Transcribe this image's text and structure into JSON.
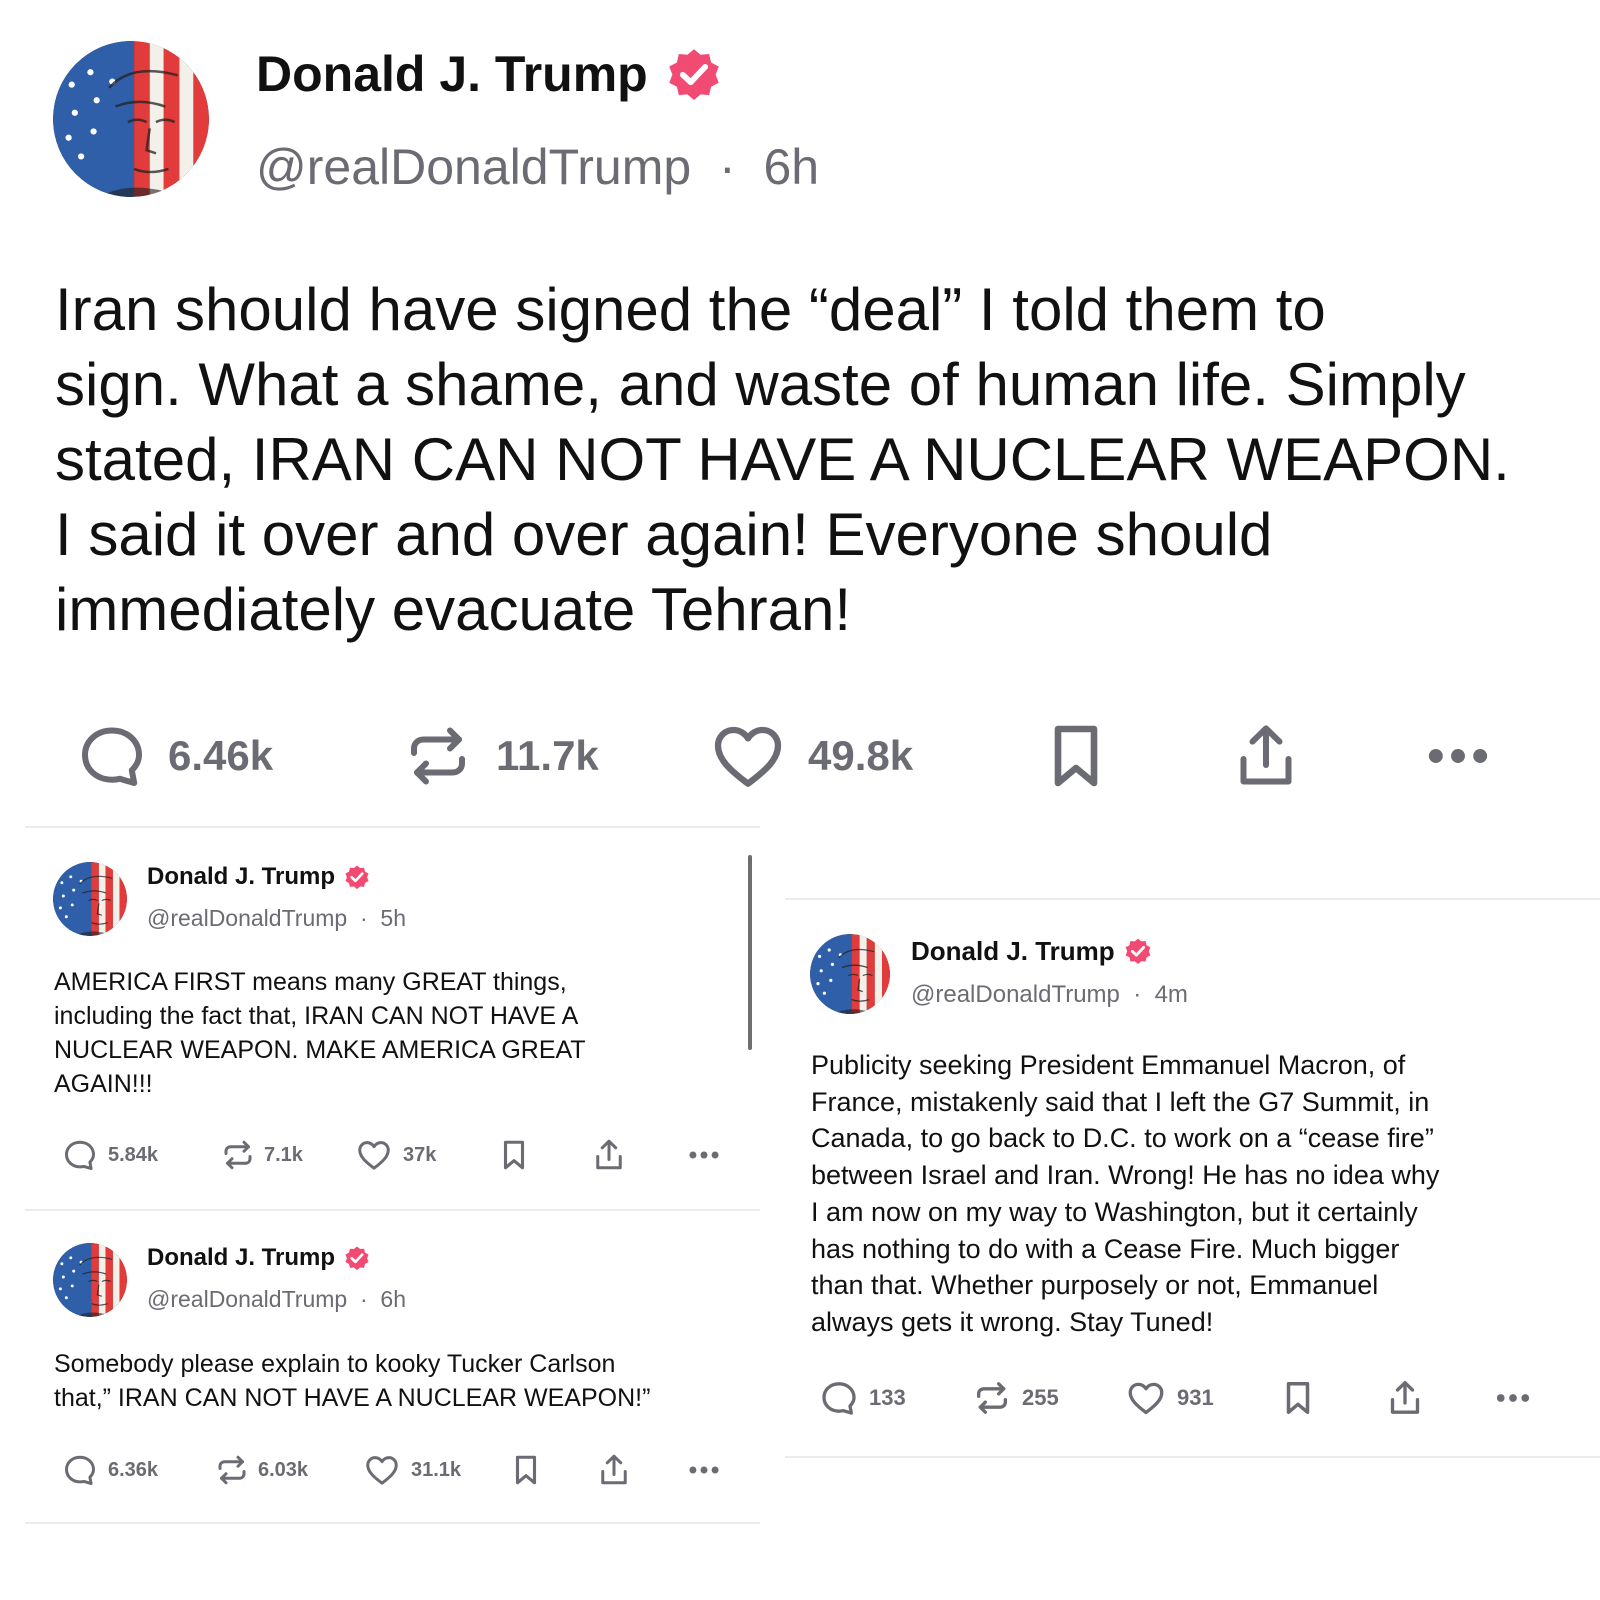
{
  "main_post": {
    "author": "Donald J. Trump",
    "handle": "@realDonaldTrump",
    "time": "6h",
    "body_lines": [
      "Iran should have signed the “deal” I told them to",
      "sign. What a shame, and waste of human life. Simply",
      "stated, IRAN CAN NOT HAVE A NUCLEAR WEAPON.",
      "I said it over and over again! Everyone should",
      "immediately evacuate Tehran!"
    ],
    "replies": "6.46k",
    "reposts": "11.7k",
    "likes": "49.8k"
  },
  "left_posts": [
    {
      "author": "Donald J. Trump",
      "handle": "@realDonaldTrump",
      "time": "5h",
      "body_lines": [
        "AMERICA FIRST means many GREAT things,",
        "including the fact that, IRAN CAN NOT HAVE A",
        "NUCLEAR WEAPON. MAKE AMERICA GREAT",
        "AGAIN!!!"
      ],
      "replies": "5.84k",
      "reposts": "7.1k",
      "likes": "37k"
    },
    {
      "author": "Donald J. Trump",
      "handle": "@realDonaldTrump",
      "time": "6h",
      "body_lines": [
        "Somebody please explain to kooky Tucker Carlson",
        "that,” IRAN CAN NOT HAVE A NUCLEAR WEAPON!”"
      ],
      "replies": "6.36k",
      "reposts": "6.03k",
      "likes": "31.1k"
    }
  ],
  "right_post": {
    "author": "Donald J. Trump",
    "handle": "@realDonaldTrump",
    "time": "4m",
    "body_lines": [
      "Publicity seeking President Emmanuel Macron, of",
      "France, mistakenly said that I left the G7 Summit, in",
      "Canada, to go back to D.C. to work on a “cease fire”",
      "between Israel and Iran. Wrong! He has no idea why",
      "I am now on my way to Washington, but it certainly",
      "has nothing to do with a Cease Fire. Much bigger",
      "than that. Whether purposely or not, Emmanuel",
      "always gets it wrong. Stay Tuned!"
    ],
    "replies": "133",
    "reposts": "255",
    "likes": "931"
  },
  "separator": "·",
  "colors": {
    "verified_badge": "#f24b73",
    "icon_gray": "#6b6b73",
    "text": "#111111",
    "divider": "#ececef"
  },
  "icons": {
    "reply": "speech-bubble-icon",
    "repost": "repost-arrows-icon",
    "like": "heart-icon",
    "bookmark": "bookmark-icon",
    "share": "share-upload-icon",
    "more": "ellipsis-icon"
  }
}
